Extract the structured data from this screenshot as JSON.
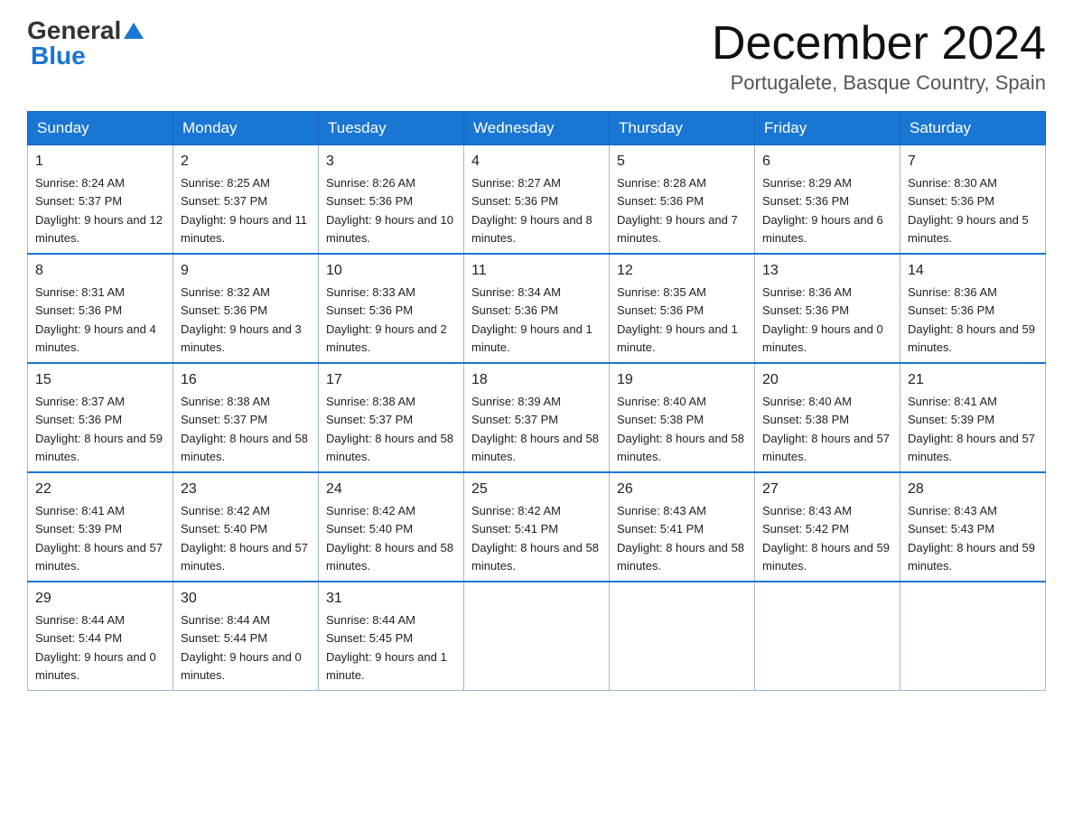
{
  "logo": {
    "general": "General",
    "blue": "Blue",
    "triangle": "▲"
  },
  "title": {
    "month_year": "December 2024",
    "location": "Portugalete, Basque Country, Spain"
  },
  "weekdays": [
    "Sunday",
    "Monday",
    "Tuesday",
    "Wednesday",
    "Thursday",
    "Friday",
    "Saturday"
  ],
  "weeks": [
    [
      {
        "day": "1",
        "sunrise": "8:24 AM",
        "sunset": "5:37 PM",
        "daylight": "9 hours and 12 minutes."
      },
      {
        "day": "2",
        "sunrise": "8:25 AM",
        "sunset": "5:37 PM",
        "daylight": "9 hours and 11 minutes."
      },
      {
        "day": "3",
        "sunrise": "8:26 AM",
        "sunset": "5:36 PM",
        "daylight": "9 hours and 10 minutes."
      },
      {
        "day": "4",
        "sunrise": "8:27 AM",
        "sunset": "5:36 PM",
        "daylight": "9 hours and 8 minutes."
      },
      {
        "day": "5",
        "sunrise": "8:28 AM",
        "sunset": "5:36 PM",
        "daylight": "9 hours and 7 minutes."
      },
      {
        "day": "6",
        "sunrise": "8:29 AM",
        "sunset": "5:36 PM",
        "daylight": "9 hours and 6 minutes."
      },
      {
        "day": "7",
        "sunrise": "8:30 AM",
        "sunset": "5:36 PM",
        "daylight": "9 hours and 5 minutes."
      }
    ],
    [
      {
        "day": "8",
        "sunrise": "8:31 AM",
        "sunset": "5:36 PM",
        "daylight": "9 hours and 4 minutes."
      },
      {
        "day": "9",
        "sunrise": "8:32 AM",
        "sunset": "5:36 PM",
        "daylight": "9 hours and 3 minutes."
      },
      {
        "day": "10",
        "sunrise": "8:33 AM",
        "sunset": "5:36 PM",
        "daylight": "9 hours and 2 minutes."
      },
      {
        "day": "11",
        "sunrise": "8:34 AM",
        "sunset": "5:36 PM",
        "daylight": "9 hours and 1 minute."
      },
      {
        "day": "12",
        "sunrise": "8:35 AM",
        "sunset": "5:36 PM",
        "daylight": "9 hours and 1 minute."
      },
      {
        "day": "13",
        "sunrise": "8:36 AM",
        "sunset": "5:36 PM",
        "daylight": "9 hours and 0 minutes."
      },
      {
        "day": "14",
        "sunrise": "8:36 AM",
        "sunset": "5:36 PM",
        "daylight": "8 hours and 59 minutes."
      }
    ],
    [
      {
        "day": "15",
        "sunrise": "8:37 AM",
        "sunset": "5:36 PM",
        "daylight": "8 hours and 59 minutes."
      },
      {
        "day": "16",
        "sunrise": "8:38 AM",
        "sunset": "5:37 PM",
        "daylight": "8 hours and 58 minutes."
      },
      {
        "day": "17",
        "sunrise": "8:38 AM",
        "sunset": "5:37 PM",
        "daylight": "8 hours and 58 minutes."
      },
      {
        "day": "18",
        "sunrise": "8:39 AM",
        "sunset": "5:37 PM",
        "daylight": "8 hours and 58 minutes."
      },
      {
        "day": "19",
        "sunrise": "8:40 AM",
        "sunset": "5:38 PM",
        "daylight": "8 hours and 58 minutes."
      },
      {
        "day": "20",
        "sunrise": "8:40 AM",
        "sunset": "5:38 PM",
        "daylight": "8 hours and 57 minutes."
      },
      {
        "day": "21",
        "sunrise": "8:41 AM",
        "sunset": "5:39 PM",
        "daylight": "8 hours and 57 minutes."
      }
    ],
    [
      {
        "day": "22",
        "sunrise": "8:41 AM",
        "sunset": "5:39 PM",
        "daylight": "8 hours and 57 minutes."
      },
      {
        "day": "23",
        "sunrise": "8:42 AM",
        "sunset": "5:40 PM",
        "daylight": "8 hours and 57 minutes."
      },
      {
        "day": "24",
        "sunrise": "8:42 AM",
        "sunset": "5:40 PM",
        "daylight": "8 hours and 58 minutes."
      },
      {
        "day": "25",
        "sunrise": "8:42 AM",
        "sunset": "5:41 PM",
        "daylight": "8 hours and 58 minutes."
      },
      {
        "day": "26",
        "sunrise": "8:43 AM",
        "sunset": "5:41 PM",
        "daylight": "8 hours and 58 minutes."
      },
      {
        "day": "27",
        "sunrise": "8:43 AM",
        "sunset": "5:42 PM",
        "daylight": "8 hours and 59 minutes."
      },
      {
        "day": "28",
        "sunrise": "8:43 AM",
        "sunset": "5:43 PM",
        "daylight": "8 hours and 59 minutes."
      }
    ],
    [
      {
        "day": "29",
        "sunrise": "8:44 AM",
        "sunset": "5:44 PM",
        "daylight": "9 hours and 0 minutes."
      },
      {
        "day": "30",
        "sunrise": "8:44 AM",
        "sunset": "5:44 PM",
        "daylight": "9 hours and 0 minutes."
      },
      {
        "day": "31",
        "sunrise": "8:44 AM",
        "sunset": "5:45 PM",
        "daylight": "9 hours and 1 minute."
      },
      null,
      null,
      null,
      null
    ]
  ]
}
